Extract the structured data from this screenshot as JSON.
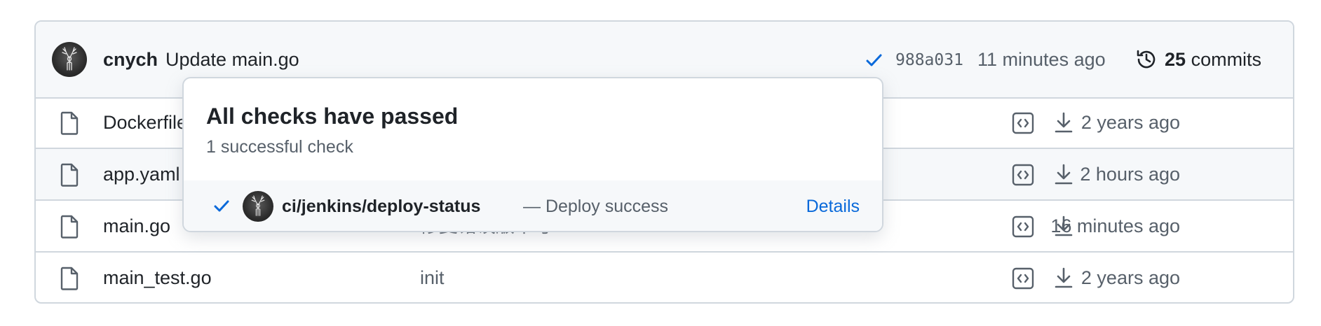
{
  "commit": {
    "author": "cnych",
    "message": "Update main.go",
    "sha": "988a031",
    "time": "11 minutes ago",
    "commit_count": "25",
    "commit_count_label": "commits",
    "status_color": "#0969da"
  },
  "files": [
    {
      "name": "Dockerfile",
      "message": "",
      "time": "2 years ago"
    },
    {
      "name": "app.yaml",
      "message": "",
      "time": "2 hours ago"
    },
    {
      "name": "main.go",
      "message": "修复错误版本号",
      "time": "16 minutes ago"
    },
    {
      "name": "main_test.go",
      "message": "init",
      "time": "2 years ago"
    }
  ],
  "checks_popover": {
    "title": "All checks have passed",
    "subtitle": "1 successful check",
    "check": {
      "name": "ci/jenkins/deploy-status",
      "description": "— Deploy success",
      "details_label": "Details"
    }
  },
  "icons": {
    "check": "check-icon",
    "history": "history-icon",
    "file": "file-icon",
    "code": "code-square-icon",
    "download": "download-icon",
    "avatar": "deer-avatar"
  }
}
